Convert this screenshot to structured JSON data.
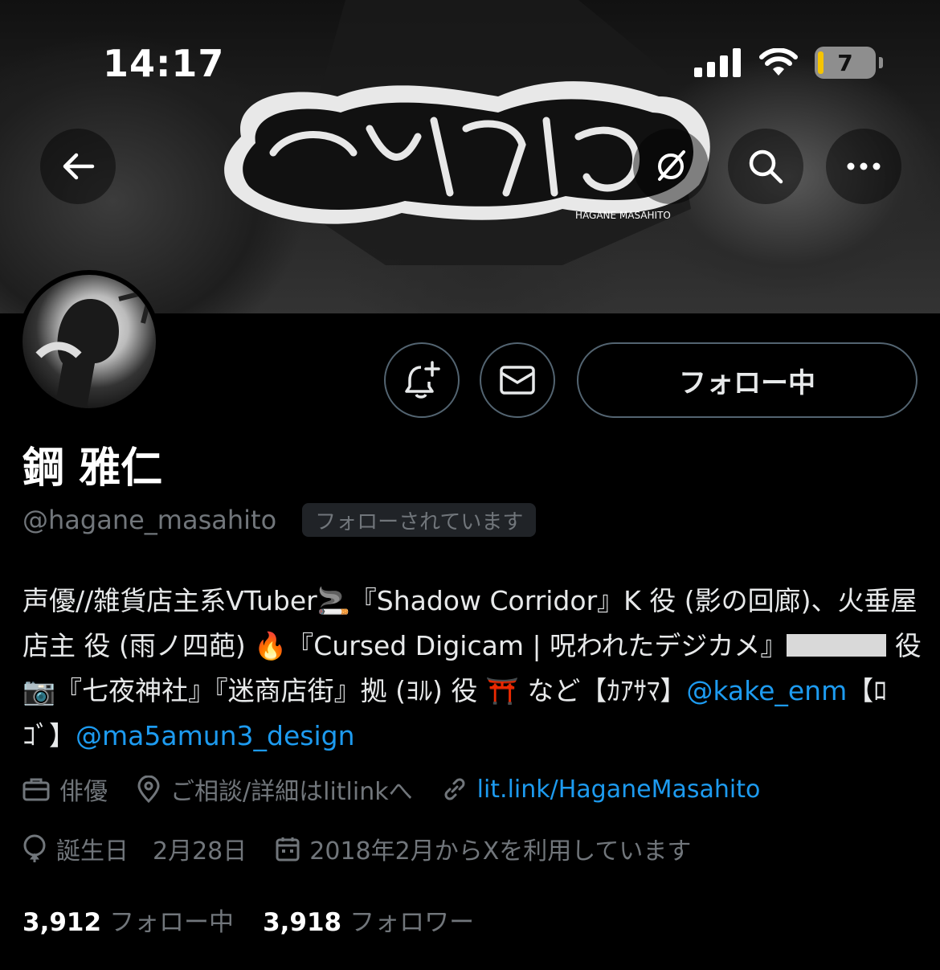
{
  "status_bar": {
    "time": "14:17",
    "battery": "7",
    "icons": [
      "cellular-signal-icon",
      "wifi-icon",
      "battery-icon"
    ]
  },
  "banner": {
    "logo_text": "HAGANE MASAHITO"
  },
  "nav": {
    "icons": [
      "back-arrow-icon",
      "grok-icon",
      "search-icon",
      "more-icon"
    ]
  },
  "actions": {
    "follow_label": "フォロー中",
    "icons": [
      "notification-add-icon",
      "mail-icon"
    ]
  },
  "profile": {
    "display_name": "鋼 雅仁",
    "handle": "@hagane_masahito",
    "follows_you": "フォローされています"
  },
  "bio": {
    "line1_a": "声優//雑貨店主系VTuber🚬『Shadow Corridor』K 役 (影の回廊)、火垂屋店主 役 (雨ノ四葩) 🔥『Cursed Digicam | 呪われたデジカメ』",
    "line1_b": " 役📷『七夜神社』『迷商店街』拠 (ﾖﾙ) 役 ⛩️ など【ｶｱｻﾏ】",
    "mention1": "@kake_enm",
    "mid": "【ﾛｺﾞ】",
    "mention2": "@ma5amun3_design"
  },
  "meta": {
    "profession": "俳優",
    "location": "ご相談/詳細はlitlinkへ",
    "website": "lit.link/HaganeMasahito",
    "birthday": "誕生日　2月28日",
    "joined": "2018年2月からXを利用しています"
  },
  "counts": {
    "following_num": "3,912",
    "following_label": "フォロー中",
    "followers_num": "3,918",
    "followers_label": "フォロワー"
  },
  "colors": {
    "background": "#000000",
    "text": "#e7e9ea",
    "secondary": "#71767b",
    "link": "#1d9bf0",
    "border": "#536471"
  }
}
